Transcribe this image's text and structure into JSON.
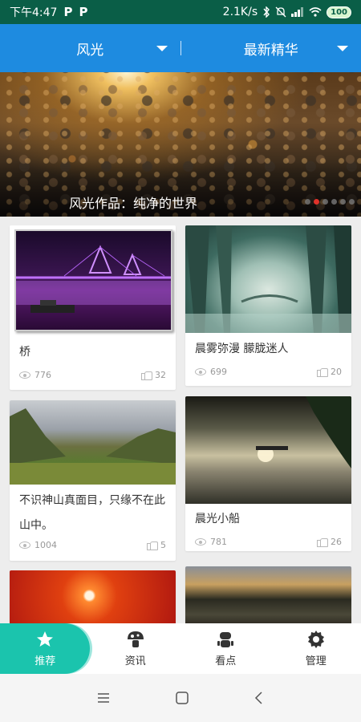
{
  "status_bar": {
    "time": "下午4:47",
    "app_badges": [
      "P",
      "P"
    ],
    "speed": "2.1K/s",
    "battery": "100"
  },
  "header": {
    "tabs": [
      {
        "label": "风光"
      },
      {
        "label": "最新精华"
      }
    ]
  },
  "banner": {
    "caption": "风光作品：纯净的世界",
    "dots_total": 6,
    "dots_active": 1
  },
  "cards": [
    {
      "title": "桥",
      "views": "776",
      "likes": "32"
    },
    {
      "title": "晨雾弥漫  朦胧迷人",
      "views": "699",
      "likes": "20"
    },
    {
      "title": "不识神山真面目，只缘不在此山中。",
      "views": "1004",
      "likes": "5"
    },
    {
      "title": "晨光小船",
      "views": "781",
      "likes": "26"
    }
  ],
  "bottom_nav": {
    "items": [
      {
        "label": "推荐",
        "icon": "star-icon"
      },
      {
        "label": "资讯",
        "icon": "mushroom-icon"
      },
      {
        "label": "看点",
        "icon": "robot-icon"
      },
      {
        "label": "管理",
        "icon": "gear-icon"
      }
    ]
  },
  "colors": {
    "status_bar": "#0a5e47",
    "header": "#1e8be0",
    "active_nav": "#1bc4ad",
    "banner_dot_active": "#e0322a"
  }
}
